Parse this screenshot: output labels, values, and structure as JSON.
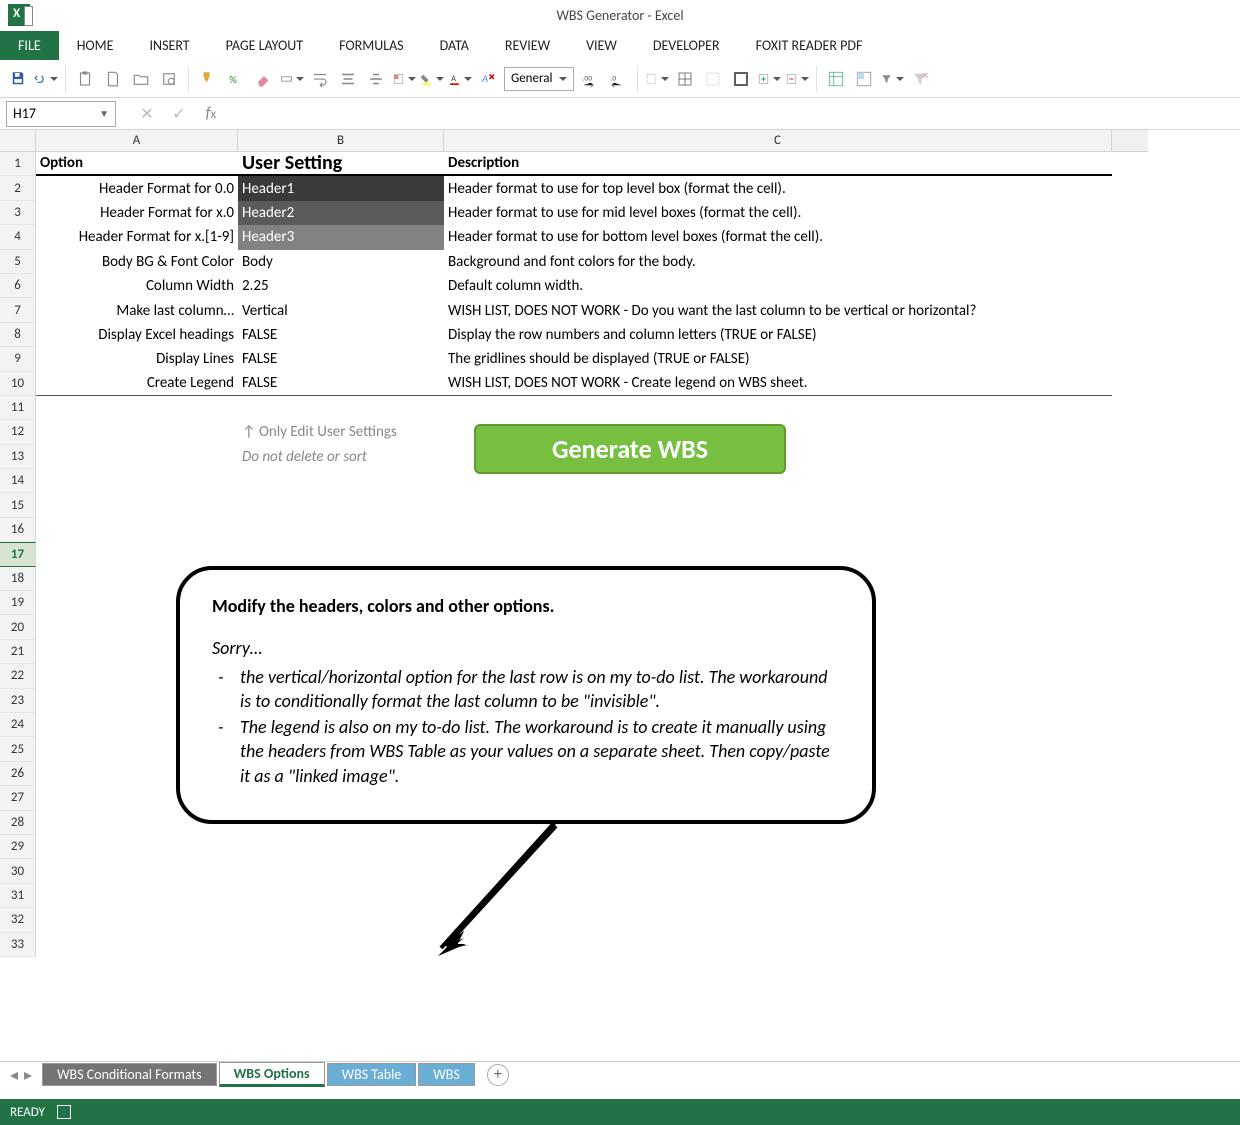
{
  "app": {
    "title": "WBS Generator - Excel"
  },
  "ribbon": {
    "tabs": [
      "FILE",
      "HOME",
      "INSERT",
      "PAGE LAYOUT",
      "FORMULAS",
      "DATA",
      "REVIEW",
      "VIEW",
      "DEVELOPER",
      "FOXIT READER PDF"
    ],
    "number_format": "General"
  },
  "namebox": "H17",
  "formula": "",
  "columns": [
    "A",
    "B",
    "C"
  ],
  "row_count": 33,
  "selected_row": 17,
  "headers": {
    "A": "Option",
    "B": "User Setting",
    "C": "Description"
  },
  "rows": [
    {
      "a": "Header Format for 0.0",
      "b": "Header1",
      "c": "Header format to use for top level box (format the cell).",
      "style": "header1"
    },
    {
      "a": "Header Format for x.0",
      "b": "Header2",
      "c": "Header format to use for mid level boxes (format the cell).",
      "style": "header2"
    },
    {
      "a": "Header Format for x.[1-9]",
      "b": "Header3",
      "c": "Header format to use for bottom level boxes (format the cell).",
      "style": "header3"
    },
    {
      "a": "Body BG & Font Color",
      "b": "Body",
      "c": "Background and font colors for the body.",
      "style": ""
    },
    {
      "a": "Column Width",
      "b": "2.25",
      "c": "Default column width.",
      "style": ""
    },
    {
      "a": "Make last column…",
      "b": "Vertical",
      "c": "WISH LIST, DOES NOT WORK - Do you want the last column to be vertical or horizontal?",
      "style": ""
    },
    {
      "a": "Display Excel headings",
      "b": "FALSE",
      "c": "Display the row numbers and column letters (TRUE or FALSE)",
      "style": ""
    },
    {
      "a": "Display Lines",
      "b": "FALSE",
      "c": "The gridlines should be displayed (TRUE or FALSE)",
      "style": ""
    },
    {
      "a": "Create Legend",
      "b": "FALSE",
      "c": "WISH LIST, DOES NOT WORK - Create legend on WBS sheet.",
      "style": ""
    }
  ],
  "hint": {
    "line1": "↑ Only Edit User Settings",
    "line2": "Do not delete or sort"
  },
  "button": "Generate WBS",
  "callout": {
    "title": "Modify the headers, colors and other options.",
    "sorry": "Sorry…",
    "items": [
      "the vertical/horizontal option for the last row is on my to-do list. The workaround is to conditionally format the last column to be \"invisible\".",
      "The legend is also on my to-do list. The workaround is to create it manually using the headers from WBS Table as your values on a separate sheet. Then copy/paste it as a \"linked image\"."
    ]
  },
  "sheets": [
    "WBS Conditional Formats",
    "WBS Options",
    "WBS Table",
    "WBS"
  ],
  "status": "READY"
}
